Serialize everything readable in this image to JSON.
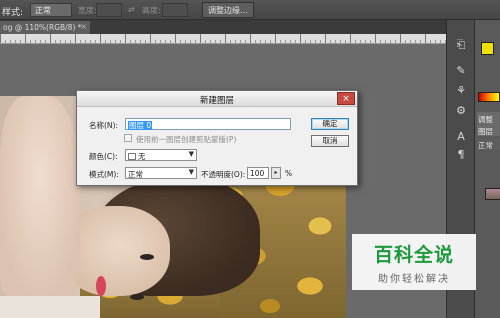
{
  "optbar": {
    "style_label": "样式:",
    "style_value": "正常",
    "width_label": "宽度:",
    "height_label": "高度:",
    "refine_edge_button": "调整边缘..."
  },
  "tab": {
    "title": "og @ 110%(RGB/8) *",
    "close": "×"
  },
  "dialog": {
    "title": "新建图层",
    "close": "×",
    "name_label": "名称(N):",
    "name_value": "图层 0",
    "clip_label": "使用前一图层创建剪贴蒙版(P)",
    "color_label": "颜色(C):",
    "color_value": "无",
    "mode_label": "模式(M):",
    "mode_value": "正常",
    "opacity_label": "不透明度(O):",
    "opacity_value": "100",
    "opacity_unit": "%",
    "ok_button": "确定",
    "cancel_button": "取消"
  },
  "panel": {
    "adjust_tab": "调整",
    "layers_tab": "图层",
    "normal_label": "正常"
  },
  "watermark": {
    "brand": "百科全说",
    "slogan": "助你轻松解决"
  },
  "colors": {
    "foreground": "#f0e000",
    "dialog_close": "#c74a3e",
    "watermark_green": "#1c9a3b"
  }
}
